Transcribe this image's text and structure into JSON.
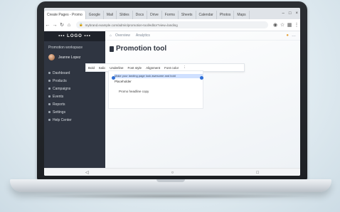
{
  "browser": {
    "active_tab": "Create Pages - Promo",
    "tabs": [
      "Google",
      "Mail",
      "Slides",
      "Docs",
      "Drive",
      "Forms",
      "Sheets",
      "Calendar",
      "Photos",
      "Maps"
    ],
    "url": "mybrand.example.com/admin/promotion-tool/editor?view=landing"
  },
  "sidebar": {
    "logo": "••• LOGO •••",
    "workspace": "Promotion workspace",
    "user": "Jeanne Lopez",
    "items": [
      "Dashboard",
      "Products",
      "Campaigns",
      "Events",
      "Reports",
      "Settings",
      "Help Center"
    ]
  },
  "topnav": {
    "items": [
      "Overview",
      "Analytics"
    ]
  },
  "page": {
    "title": "Promotion tool"
  },
  "editor_toolbar": {
    "items": [
      "Bold",
      "Italic",
      "Underline",
      "Font style",
      "Alignment",
      "Font color"
    ]
  },
  "editor": {
    "selected_text": "Make your landing page look awesome and bold",
    "line2": "Placeholder",
    "line3": "Promo headline copy"
  },
  "softkeys": {
    "back": "◁",
    "home": "○",
    "recent": "□"
  },
  "colors": {
    "sidebar_bg": "#2f3541",
    "accent": "#2f6fd6",
    "selection": "#cfe0ff"
  }
}
